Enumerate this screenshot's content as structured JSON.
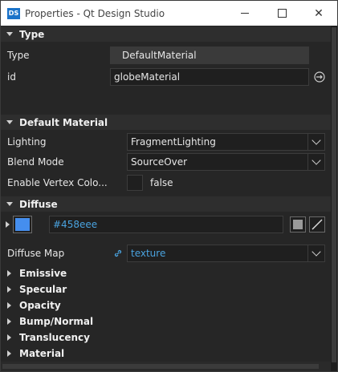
{
  "window": {
    "app_icon_text": "DS",
    "title": "Properties - Qt Design Studio",
    "min_icon": "minimize-icon",
    "max_icon": "maximize-icon",
    "close_glyph": "✕"
  },
  "type_section": {
    "header": "Type",
    "type_label": "Type",
    "type_value": "DefaultMaterial",
    "id_label": "id",
    "id_value": "globeMaterial"
  },
  "default_material_section": {
    "header": "Default Material",
    "lighting_label": "Lighting",
    "lighting_value": "FragmentLighting",
    "blend_label": "Blend Mode",
    "blend_value": "SourceOver",
    "vertex_label": "Enable Vertex Colo...",
    "vertex_value": "false"
  },
  "diffuse_section": {
    "header": "Diffuse",
    "color_hex": "#458eee",
    "map_label": "Diffuse Map",
    "map_value": "texture"
  },
  "collapsed_sections": [
    "Emissive",
    "Specular",
    "Opacity",
    "Bump/Normal",
    "Translucency",
    "Material"
  ],
  "colors": {
    "accent": "#458eee",
    "link": "#4aa3df",
    "background": "#262626"
  }
}
